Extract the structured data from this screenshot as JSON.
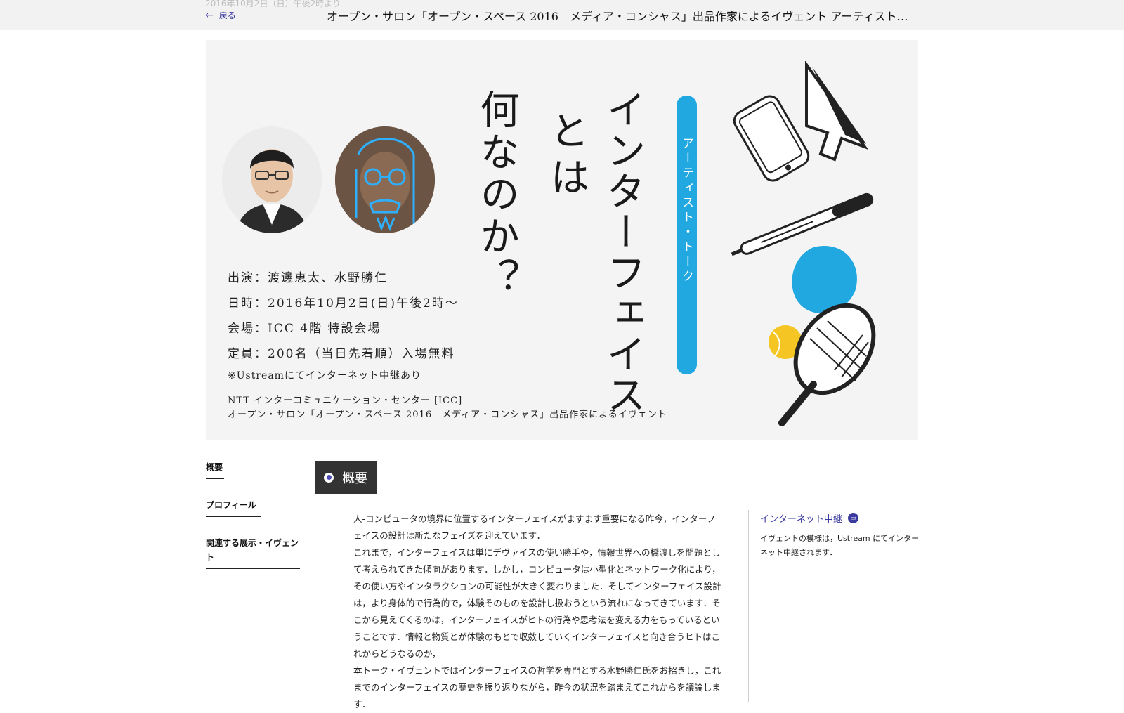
{
  "topbar": {
    "date_ghost": "2016年10月2日（日）午後2時より",
    "back_label": "戻る",
    "title": "オープン・サロン「オープン・スペース 2016　メディア・コンシャス」出品作家によるイヴェント アーティスト・トーク「インターフェイスとは何なのか？」"
  },
  "hero": {
    "title_main": "インターフェイス",
    "title_towa": "とは",
    "title_nani": "何なのか？",
    "pill": "アーティスト・トーク",
    "info": [
      "出演：渡邊恵太、水野勝仁",
      "日時：2016年10月2日(日)午後2時〜",
      "会場：ICC 4階 特設会場",
      "定員：200名（当日先着順）入場無料"
    ],
    "note": "※Ustreamにてインターネット中継あり",
    "org_line1": "NTT インターコミュニケーション・センター [ICC]",
    "org_line2": "オープン・サロン「オープン・スペース 2016　メディア・コンシャス」出品作家によるイヴェント"
  },
  "sidenav": {
    "items": [
      {
        "label": "概要"
      },
      {
        "label": "プロフィール"
      },
      {
        "label": "関連する展示・イヴェント"
      }
    ]
  },
  "section": {
    "heading": "概要"
  },
  "body": {
    "paragraphs": [
      "人-コンピュータの境界に位置するインターフェイスがますます重要になる昨今，インターフェイスの設計は新たなフェイズを迎えています．",
      "これまで，インターフェイスは単にデヴァイスの使い勝手や，情報世界への橋渡しを問題として考えられてきた傾向があります．しかし，コンピュータは小型化とネットワーク化により，その使い方やインタラクションの可能性が大きく変わりました．そしてインターフェイス設計は，より身体的で行為的で，体験そのものを設計し扱おうという流れになってきています．そこから見えてくるのは，インターフェイスがヒトの行為や思考法を変える力をもっているということです．情報と物質とが体験のもとで収斂していくインターフェイスと向き合うヒトはこれからどうなるのか，",
      "本トーク・イヴェントではインターフェイスの哲学を専門とする水野勝仁氏をお招きし，これまでのインターフェイスの歴史を振り返りながら，昨今の状況を踏まえてこれからを議論します．"
    ]
  },
  "aside": {
    "title": "インターネット中継",
    "text": "イヴェントの模様は，Ustream にてインターネット中継されます．"
  },
  "colors": {
    "accent": "#3a3aa0",
    "pill": "#21a8e0",
    "ball": "#f5c623",
    "section_bg": "#333333"
  },
  "icons": [
    "arrow-left-icon",
    "broadcast-icon",
    "radio-dot-icon"
  ]
}
